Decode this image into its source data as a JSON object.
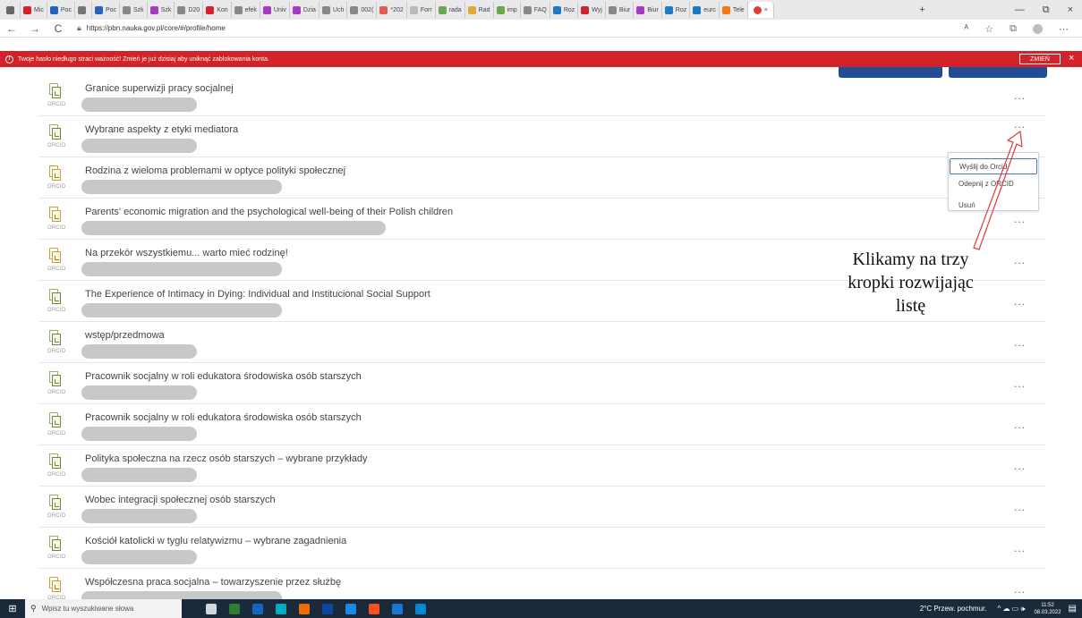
{
  "browser": {
    "tabs": [
      {
        "label": "",
        "color": "#666666"
      },
      {
        "label": "Mic",
        "color": "#d2232a"
      },
      {
        "label": "Poc",
        "color": "#2563b8"
      },
      {
        "label": "",
        "color": "#777777"
      },
      {
        "label": "Poc",
        "color": "#2563b8"
      },
      {
        "label": "Szk",
        "color": "#888888"
      },
      {
        "label": "Szk",
        "color": "#a33dbb"
      },
      {
        "label": "D20",
        "color": "#888888"
      },
      {
        "label": "Kon",
        "color": "#d2232a"
      },
      {
        "label": "efek",
        "color": "#888888"
      },
      {
        "label": "Univ",
        "color": "#a33dbb"
      },
      {
        "label": "Dzia",
        "color": "#a33dbb"
      },
      {
        "label": "Uch",
        "color": "#888888"
      },
      {
        "label": "002(",
        "color": "#888888"
      },
      {
        "label": "*202",
        "color": "#e35b4b"
      },
      {
        "label": "Forr",
        "color": "#bbbbbb"
      },
      {
        "label": "rada",
        "color": "#6aa84f"
      },
      {
        "label": "Rad",
        "color": "#e3a83b"
      },
      {
        "label": "imp",
        "color": "#6aa84f"
      },
      {
        "label": "FAQ",
        "color": "#888888"
      },
      {
        "label": "Roz",
        "color": "#1f78c1"
      },
      {
        "label": "Wyj",
        "color": "#d2232a"
      },
      {
        "label": "Biur",
        "color": "#888888"
      },
      {
        "label": "Biur",
        "color": "#a33dbb"
      },
      {
        "label": "Roz",
        "color": "#1f78c1"
      },
      {
        "label": "eurc",
        "color": "#1f78c1"
      },
      {
        "label": "Tele",
        "color": "#f07a1a"
      }
    ],
    "active_tab": {
      "label": "",
      "close": "×"
    },
    "new_tab": "+",
    "window_controls": {
      "minimize": "—",
      "restore": "⧉",
      "close": "×"
    },
    "nav": {
      "back": "←",
      "forward": "→",
      "reload": "C"
    },
    "url": "https://pbn.nauka.gov.pl/core/#/profile/home"
  },
  "banner": {
    "text": "Twoje hasło niedługo straci ważność! Zmień je już dzisiaj aby uniknąć zablokowania konta.",
    "button": "ZMIEŃ",
    "close": "×",
    "color": "#d2232a"
  },
  "publications": [
    {
      "title": "Granice superwizji pracy socjalnej",
      "orcid": "ORCID",
      "author_bar": 0.38
    },
    {
      "title": "Wybrane aspekty z etyki mediatora",
      "orcid": "ORCID",
      "author_bar": 0.38
    },
    {
      "title": "Rodzina z wieloma problemami w optyce polityki społecznej",
      "orcid": "ORCID",
      "author_bar": 0.66
    },
    {
      "title": "Parents' economic migration and the psychological well-being of their Polish children",
      "orcid": "ORCID",
      "author_bar": 1.0
    },
    {
      "title": "Na przekór wszystkiemu... warto mieć rodzinę!",
      "orcid": "ORCID",
      "author_bar": 0.66
    },
    {
      "title": "The Experience of Intimacy in Dying: Individual and Institucional Social Support",
      "orcid": "ORCID",
      "author_bar": 0.66
    },
    {
      "title": "wstęp/przedmowa",
      "orcid": "ORCID",
      "author_bar": 0.38
    },
    {
      "title": "Pracownik socjalny w roli edukatora środowiska osób starszych",
      "orcid": "ORCID",
      "author_bar": 0.38
    },
    {
      "title": "Pracownik socjalny w roli edukatora środowiska osób starszych",
      "orcid": "ORCID",
      "author_bar": 0.38
    },
    {
      "title": "Polityka społeczna na rzecz osób starszych – wybrane przykłady",
      "orcid": "ORCID",
      "author_bar": 0.38
    },
    {
      "title": "Wobec integracji społecznej osób starszych",
      "orcid": "ORCID",
      "author_bar": 0.38
    },
    {
      "title": "Kościół katolicki w tyglu relatywizmu – wybrane zagadnienia",
      "orcid": "ORCID",
      "author_bar": 0.38
    },
    {
      "title": "Współczesna praca socjalna – towarzyszenie przez służbę",
      "orcid": "ORCID",
      "author_bar": 0.66
    }
  ],
  "row_menu_label": "...",
  "context_menu": {
    "items": [
      "Wyślij do Orcid",
      "Odepnij z ORCID",
      "Usuń"
    ],
    "highlighted": 0
  },
  "annotation": {
    "lines": [
      "Klikamy na trzy",
      "kropki rozwijając",
      "listę"
    ]
  },
  "taskbar": {
    "search_placeholder": "Wpisz tu wyszukiwane słowa",
    "weather": "2°C  Przew. pochmur.",
    "tray": "^ ☁ ▭ 🕪",
    "time": "11:52",
    "date": "08.03.2022",
    "app_colors": [
      "#cfd8dc",
      "#2e7d32",
      "#1565c0",
      "#00acc1",
      "#ef6c00",
      "#0d47a1",
      "#1e88e5",
      "#f4511e",
      "#1976d2",
      "#0288d1"
    ]
  }
}
